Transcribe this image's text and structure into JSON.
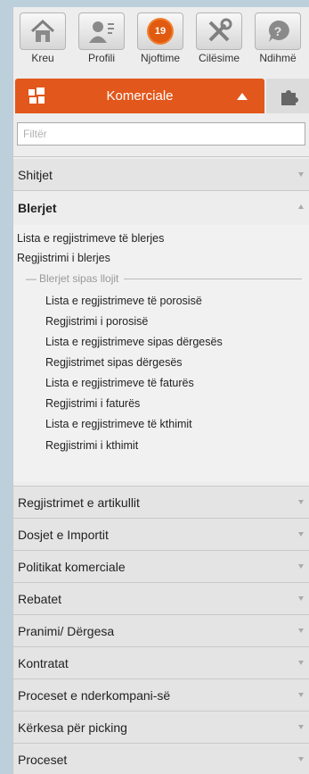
{
  "toolbar": [
    {
      "label": "Kreu",
      "icon": "home-icon"
    },
    {
      "label": "Profili",
      "icon": "profile-icon"
    },
    {
      "label": "Njoftime",
      "icon": "notification-icon",
      "badge": "19"
    },
    {
      "label": "Cilësime",
      "icon": "tools-icon"
    },
    {
      "label": "Ndihmë",
      "icon": "help-icon"
    }
  ],
  "module": {
    "label": "Komerciale",
    "accent": "#e2571b"
  },
  "filter": {
    "placeholder": "Filtër",
    "value": ""
  },
  "sections": [
    {
      "label": "Shitjet"
    },
    {
      "label": "Blerjet",
      "expanded": true
    },
    {
      "label": "Regjistrimet e artikullit"
    },
    {
      "label": "Dosjet e Importit"
    },
    {
      "label": "Politikat komerciale"
    },
    {
      "label": "Rebatet"
    },
    {
      "label": "Pranimi/ Dërgesa"
    },
    {
      "label": "Kontratat"
    },
    {
      "label": "Proceset e nderkompani-së"
    },
    {
      "label": "Kërkesa për picking"
    },
    {
      "label": "Proceset"
    }
  ],
  "blerjet": {
    "items": [
      "Lista e regjistrimeve të blerjes",
      "Regjistrimi i blerjes"
    ],
    "group_label": "Blerjet sipas llojit",
    "group_items": [
      "Lista e regjistrimeve të porosisë",
      "Regjistrimi i porosisë",
      "Lista e regjistrimeve sipas dërgesës",
      "Regjistrimet sipas dërgesës",
      "Lista e regjistrimeve të faturës",
      "Regjistrimi i faturës",
      "Lista e regjistrimeve të kthimit",
      "Regjistrimi i kthimit"
    ]
  }
}
